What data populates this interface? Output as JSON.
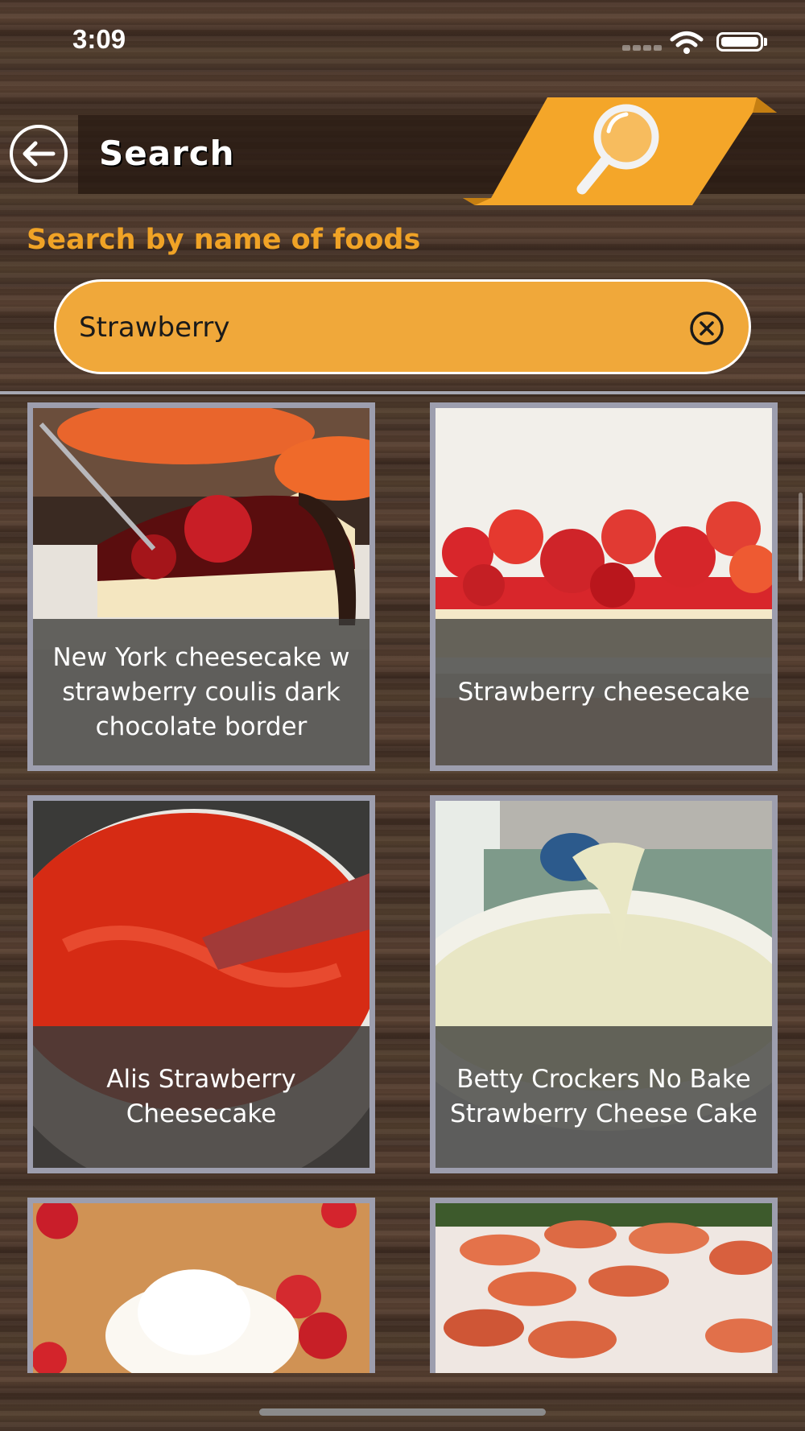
{
  "status_bar": {
    "time": "3:09"
  },
  "header": {
    "title": "Search",
    "back_label": "Back"
  },
  "search": {
    "subtitle": "Search by name of foods",
    "query": "Strawberry",
    "placeholder": ""
  },
  "results": [
    {
      "name": "New York cheesecake w strawberry coulis dark chocolate border"
    },
    {
      "name": "Strawberry cheesecake"
    },
    {
      "name": "Alis Strawberry Cheesecake"
    },
    {
      "name": "Betty Crockers No Bake Strawberry Cheese Cake"
    },
    {
      "name": ""
    },
    {
      "name": ""
    }
  ],
  "colors": {
    "accent": "#f0a326",
    "field": "#f0a83a",
    "card_border": "#9d9eae"
  }
}
